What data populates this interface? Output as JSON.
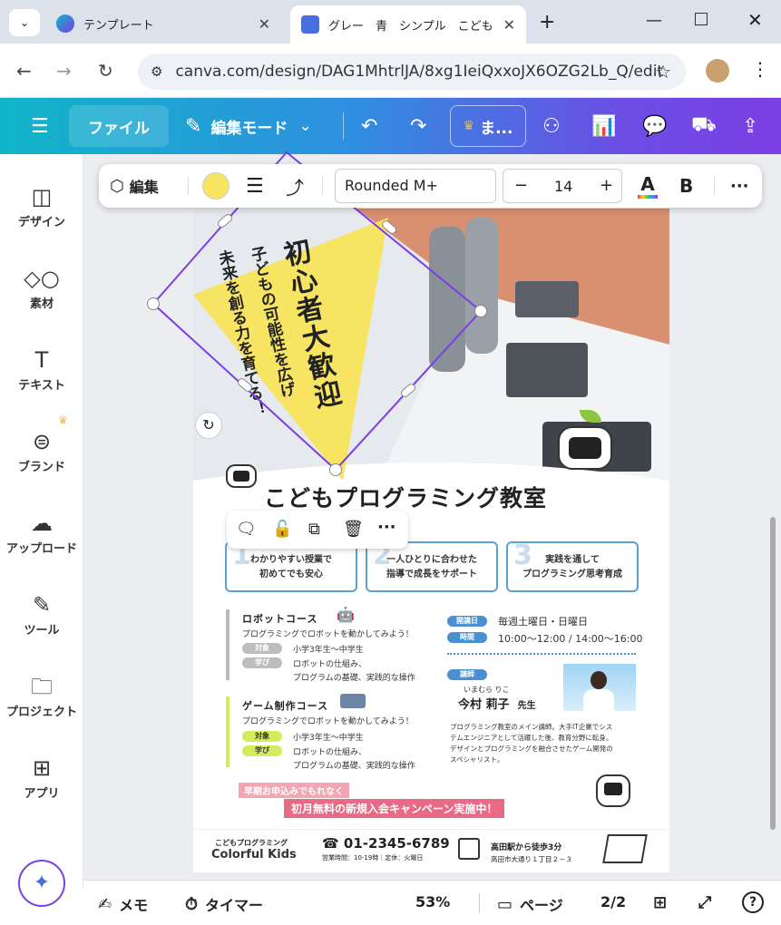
{
  "browser": {
    "tabs": [
      {
        "title": "テンプレート",
        "active": false
      },
      {
        "title": "グレー　青　シンプル　こども",
        "active": true
      }
    ],
    "url": "canva.com/design/DAG1MhtrlJA/8xg1IeiQxxoJX6OZG2Lb_Q/edit"
  },
  "toolbar": {
    "file_label": "ファイル",
    "edit_mode_label": "編集モード",
    "premium_label": "ま..."
  },
  "sidebar": {
    "items": [
      {
        "label": "デザイン"
      },
      {
        "label": "素材"
      },
      {
        "label": "テキスト"
      },
      {
        "label": "ブランド"
      },
      {
        "label": "アップロード"
      },
      {
        "label": "ツール"
      },
      {
        "label": "プロジェクト"
      },
      {
        "label": "アプリ"
      }
    ]
  },
  "floating_toolbar": {
    "edit_label": "編集",
    "font_name": "Rounded M+",
    "font_size": "14",
    "fill_color": "#f7e463"
  },
  "poster": {
    "headline": "初心者大歓迎",
    "sub1": "子どもの可能性を広げ",
    "sub2": "未来を創る力を育てる！",
    "title": "こどもプログラミング教室",
    "features": [
      {
        "num": "1",
        "line1": "わかりやすい授業で",
        "line2": "初めてでも安心"
      },
      {
        "num": "2",
        "line1": "一人ひとりに合わせた",
        "line2": "指導で成長をサポート"
      },
      {
        "num": "3",
        "line1": "実践を通して",
        "line2": "プログラミング思考育成"
      }
    ],
    "robot_course": {
      "title": "ロボットコース",
      "desc": "プログラミングでロボットを動かしてみよう！",
      "target_label": "対象",
      "target": "小学3年生〜中学生",
      "learn_label": "学び",
      "learn1": "ロボットの仕組み、",
      "learn2": "プログラムの基礎、実践的な操作"
    },
    "game_course": {
      "title": "ゲーム制作コース",
      "desc": "プログラミングでロボットを動かしてみよう！",
      "target_label": "対象",
      "target": "小学3年生〜中学生",
      "learn_label": "学び",
      "learn1": "ロボットの仕組み、",
      "learn2": "プログラムの基礎、実践的な操作"
    },
    "schedule": {
      "day_label": "開講日",
      "day": "毎週土曜日・日曜日",
      "time_label": "時間",
      "time": "10:00〜12:00 / 14:00〜16:00"
    },
    "teacher": {
      "label": "講師",
      "kana": "いまむら りこ",
      "name": "今村 莉子",
      "honorific": "先生",
      "bio1": "プログラミング教室のメイン講師。大手IT企業でシス",
      "bio2": "テムエンジニアとして活躍した後、教育分野に転身。",
      "bio3": "デザインとプログラミングを融合させたゲーム開発の",
      "bio4": "スペシャリスト。"
    },
    "campaign1": "早期お申込みでもれなく",
    "campaign2": "初月無料の新規入会キャンペーン実施中！",
    "footer": {
      "brand_small": "こどもプログラミング",
      "brand_big": "Colorful Kids",
      "phone": "☎ 01-2345-6789",
      "hours": "営業時間：10-19時｜定休：火曜日",
      "access": "高田駅から徒歩3分",
      "address": "高田市大通り１丁目２－３"
    }
  },
  "bottombar": {
    "memo_label": "メモ",
    "timer_label": "タイマー",
    "zoom": "53%",
    "page_label": "ページ",
    "page_count": "2/2"
  },
  "colors": {
    "accent_yellow": "#f7e463",
    "feature_border": "#5aa2d6",
    "selection": "#7b3fe4"
  }
}
